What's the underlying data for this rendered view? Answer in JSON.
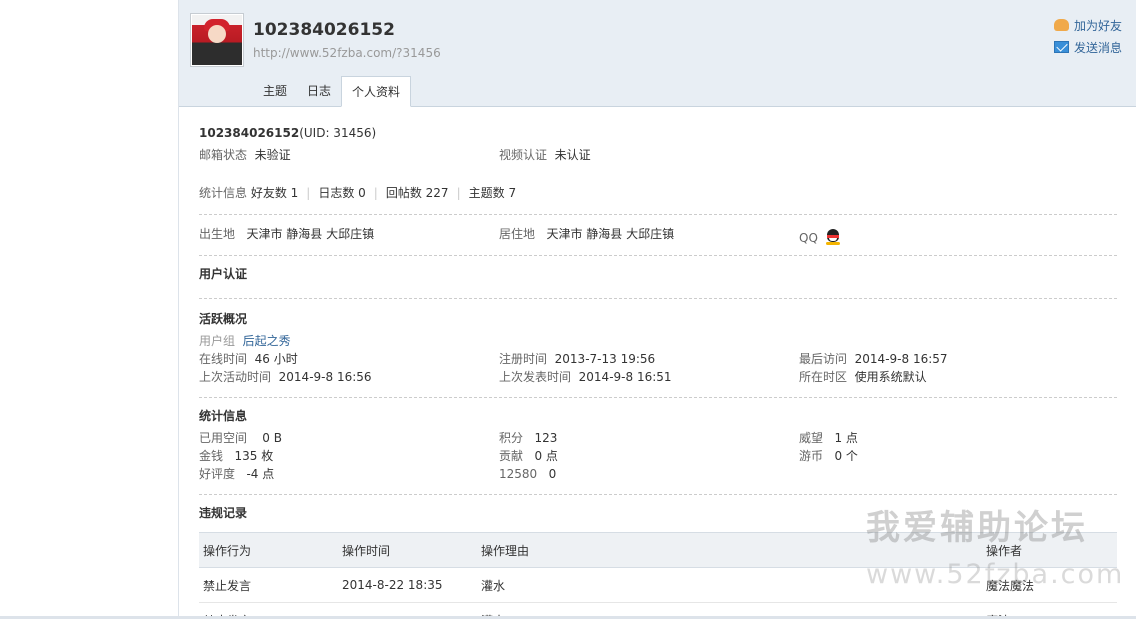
{
  "profile": {
    "username": "102384026152",
    "url": "http://www.52fzba.com/?31456",
    "uid_text": "(UID: 31456)"
  },
  "actions": [
    {
      "label": "加为好友",
      "icon": "handshake-icon"
    },
    {
      "label": "发送消息",
      "icon": "mail-icon"
    }
  ],
  "tabs": [
    {
      "label": "主题",
      "active": false
    },
    {
      "label": "日志",
      "active": false
    },
    {
      "label": "个人资料",
      "active": true
    }
  ],
  "basic": {
    "email_label": "邮箱状态",
    "email_value": "未验证",
    "video_label": "视频认证",
    "video_value": "未认证"
  },
  "stats_line": {
    "label": "统计信息",
    "friends": "好友数 1",
    "blogs": "日志数 0",
    "replies": "回帖数 227",
    "threads": "主题数 7"
  },
  "location": {
    "birth_label": "出生地",
    "birth_value": "天津市 静海县 大邱庄镇",
    "live_label": "居住地",
    "live_value": "天津市 静海县 大邱庄镇",
    "qq_label": "QQ"
  },
  "auth_section": {
    "title": "用户认证"
  },
  "activity": {
    "title": "活跃概况",
    "group_label": "用户组",
    "group_value": "后起之秀",
    "online_label": "在线时间",
    "online_value": "46 小时",
    "register_label": "注册时间",
    "register_value": "2013-7-13 19:56",
    "last_visit_label": "最后访问",
    "last_visit_value": "2014-9-8 16:57",
    "last_active_label": "上次活动时间",
    "last_active_value": "2014-9-8 16:56",
    "last_post_label": "上次发表时间",
    "last_post_value": "2014-9-8 16:51",
    "timezone_label": "所在时区",
    "timezone_value": "使用系统默认"
  },
  "statistics": {
    "title": "统计信息",
    "space_label": "已用空间",
    "space_value": "0 B",
    "points_label": "积分",
    "points_value": "123",
    "prestige_label": "威望",
    "prestige_value": "1 点",
    "money_label": "金钱",
    "money_value": "135 枚",
    "contrib_label": "贡献",
    "contrib_value": "0 点",
    "coins_label": "游币",
    "coins_value": "0 个",
    "rating_label": "好评度",
    "rating_value": "-4 点",
    "extra_label": "12580",
    "extra_value": "0"
  },
  "violations": {
    "title": "违规记录",
    "headers": [
      "操作行为",
      "操作时间",
      "操作理由",
      "操作者"
    ],
    "rows": [
      [
        "禁止发言",
        "2014-8-22 18:35",
        "灌水",
        "魔法魔法"
      ],
      [
        "禁止发言",
        "",
        "灌水",
        "魔法"
      ]
    ]
  },
  "watermark": {
    "line1": "我爱辅助论坛",
    "line2": "www.52fzba.com"
  }
}
